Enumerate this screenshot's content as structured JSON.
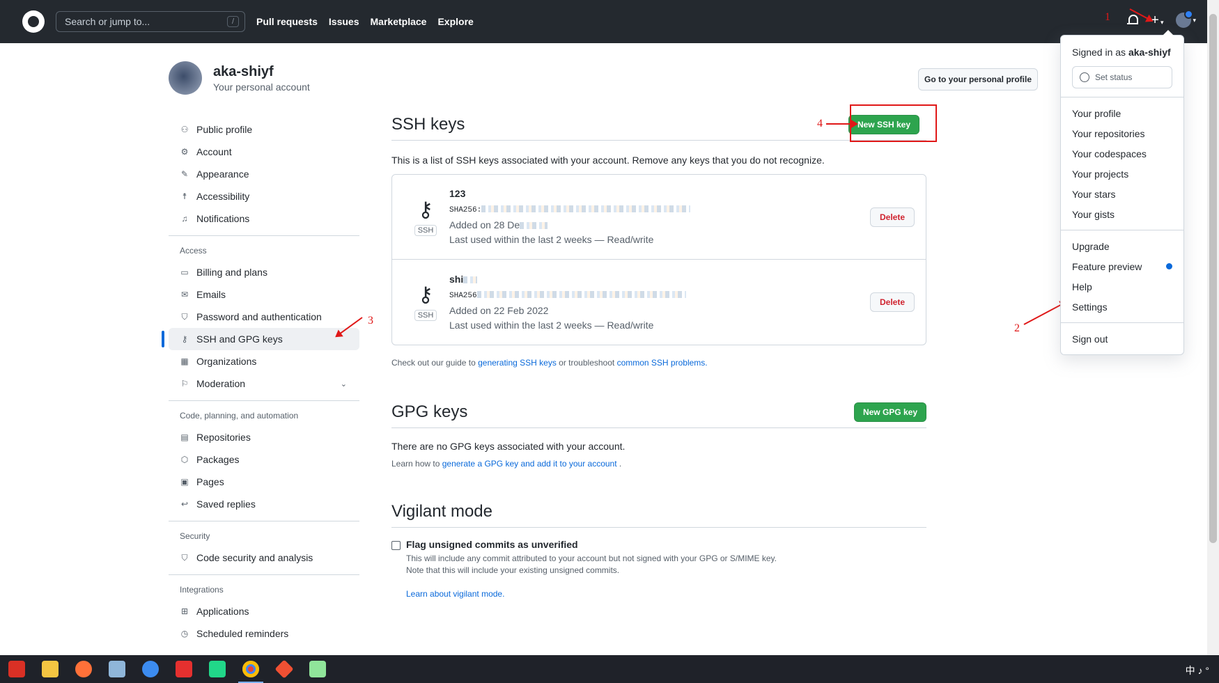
{
  "header": {
    "search_placeholder": "Search or jump to...",
    "slash_key": "/",
    "nav": [
      "Pull requests",
      "Issues",
      "Marketplace",
      "Explore"
    ],
    "plus": "+"
  },
  "dropdown": {
    "signed_in_prefix": "Signed in as",
    "username": "aka-shiyf",
    "set_status": "Set status",
    "group1": [
      "Your profile",
      "Your repositories",
      "Your codespaces",
      "Your projects",
      "Your stars",
      "Your gists"
    ],
    "group2": [
      "Upgrade",
      "Feature preview",
      "Help",
      "Settings"
    ],
    "sign_out": "Sign out"
  },
  "profile": {
    "name": "aka-shiyf",
    "subtitle": "Your personal account",
    "goto_button": "Go to your personal profile"
  },
  "sidebar": {
    "top_items": [
      "Public profile",
      "Account",
      "Appearance",
      "Accessibility",
      "Notifications"
    ],
    "access_heading": "Access",
    "access_items": [
      "Billing and plans",
      "Emails",
      "Password and authentication",
      "SSH and GPG keys",
      "Organizations",
      "Moderation"
    ],
    "code_heading": "Code, planning, and automation",
    "code_items": [
      "Repositories",
      "Packages",
      "Pages",
      "Saved replies"
    ],
    "security_heading": "Security",
    "security_items": [
      "Code security and analysis"
    ],
    "integrations_heading": "Integrations",
    "integrations_items": [
      "Applications",
      "Scheduled reminders"
    ]
  },
  "ssh": {
    "title": "SSH keys",
    "new_button": "New SSH key",
    "description": "This is a list of SSH keys associated with your account. Remove any keys that you do not recognize.",
    "badge": "SSH",
    "delete_label": "Delete",
    "keys": [
      {
        "title": "123",
        "fingerprint": "SHA256:",
        "added": "Added on 28 De",
        "last_used": "Last used within the last 2 weeks — Read/write"
      },
      {
        "title": "shi",
        "fingerprint": "SHA256",
        "added": "Added on 22 Feb 2022",
        "last_used": "Last used within the last 2 weeks — Read/write"
      }
    ],
    "guide_prefix": "Check out our guide to",
    "guide_link1": "generating SSH keys",
    "guide_mid": "or troubleshoot",
    "guide_link2": "common SSH problems."
  },
  "gpg": {
    "title": "GPG keys",
    "new_button": "New GPG key",
    "empty": "There are no GPG keys associated with your account.",
    "learn_prefix": "Learn how to",
    "learn_link": "generate a GPG key and add it to your account",
    "learn_suffix": "."
  },
  "vigilant": {
    "title": "Vigilant mode",
    "checkbox_label": "Flag unsigned commits as unverified",
    "note1": "This will include any commit attributed to your account but not signed with your GPG or S/MIME key.",
    "note2": "Note that this will include your existing unsigned commits.",
    "learn_link": "Learn about vigilant mode."
  },
  "annotations": [
    "1",
    "2",
    "3",
    "4"
  ],
  "taskbar": {
    "tray_text": "中 ♪ °",
    "icons": [
      "wps-icon",
      "file-explorer-icon",
      "firefox-icon",
      "notepad-icon",
      "feishu-icon",
      "youdao-icon",
      "pycharm-icon",
      "chrome-icon",
      "git-icon",
      "notepadpp-icon"
    ]
  },
  "colors": {
    "header_bg": "#24292f",
    "primary_green": "#2da44e",
    "link_blue": "#0969da",
    "danger_red": "#cf222e",
    "annotation_red": "#e01818"
  }
}
